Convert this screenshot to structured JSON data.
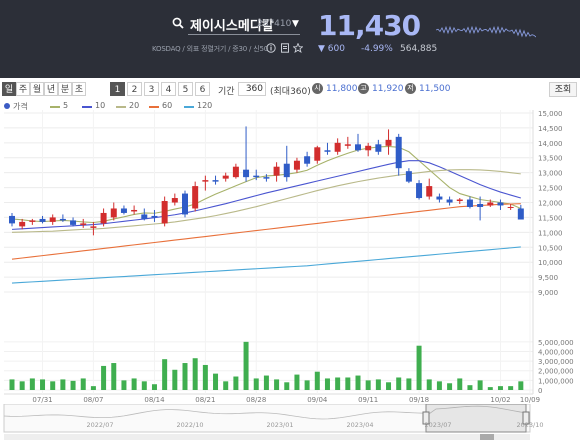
{
  "header": {
    "stock_name": "제이시스메디칼",
    "stock_code": "287410",
    "meta": "KOSDAQ / 외표 정렬거기 / 증30 / 신50",
    "price": "11,430",
    "change": "▼ 600",
    "change_pct": "-4.99%",
    "volume": "564,885",
    "colors": {
      "down": "#a9b8f5",
      "bg": "#2c2f38"
    }
  },
  "toolbar": {
    "periods": [
      "일",
      "주",
      "월",
      "년",
      "분",
      "초"
    ],
    "selected_period": "일",
    "counts": [
      "1",
      "2",
      "3",
      "4",
      "5",
      "6"
    ],
    "selected_count": "1",
    "range_label": "기간",
    "range_value": "360",
    "range_max": "(최대360)",
    "open_badge": "시",
    "open_value": "11,800",
    "high_badge": "고",
    "high_value": "11,920",
    "low_badge": "저",
    "low_value": "11,500",
    "search_label": "조회"
  },
  "legend": [
    {
      "label": "가격",
      "color": "#3b5bc4"
    },
    {
      "label": "5",
      "color": "#a7b26a"
    },
    {
      "label": "10",
      "color": "#4a55d0"
    },
    {
      "label": "20",
      "color": "#b9b98a"
    },
    {
      "label": "60",
      "color": "#e8703a"
    },
    {
      "label": "120",
      "color": "#4aa8d8"
    }
  ],
  "chart_data": {
    "type": "candlestick",
    "x_ticks": [
      "07/31",
      "08/07",
      "08/14",
      "08/21",
      "08/28",
      "09/04",
      "09/11",
      "09/18",
      "10/02",
      "10/09"
    ],
    "y_ticks": [
      9000,
      9500,
      10000,
      10500,
      11000,
      11500,
      12000,
      12500,
      13000,
      13500,
      14000,
      14500,
      15000
    ],
    "y_tick_labels": [
      "9,000",
      "9,500",
      "10,000",
      "10,500",
      "11,000",
      "11,500",
      "12,000",
      "12,500",
      "13,000",
      "13,500",
      "14,000",
      "14,500",
      "15,000"
    ],
    "ylim": [
      8800,
      15100
    ],
    "volume_ticks": [
      0,
      1000000,
      2000000,
      3000000,
      4000000,
      5000000
    ],
    "volume_tick_labels": [
      "0",
      "1,000,000",
      "2,000,000",
      "3,000,000",
      "4,000,000",
      "5,000,000"
    ],
    "candles": [
      {
        "o": 11550,
        "h": 11650,
        "l": 11200,
        "c": 11300
      },
      {
        "o": 11200,
        "h": 11450,
        "l": 11100,
        "c": 11350
      },
      {
        "o": 11350,
        "h": 11450,
        "l": 11250,
        "c": 11400
      },
      {
        "o": 11450,
        "h": 11550,
        "l": 11300,
        "c": 11350
      },
      {
        "o": 11350,
        "h": 11600,
        "l": 11250,
        "c": 11500
      },
      {
        "o": 11450,
        "h": 11600,
        "l": 11350,
        "c": 11400
      },
      {
        "o": 11400,
        "h": 11500,
        "l": 11200,
        "c": 11250
      },
      {
        "o": 11250,
        "h": 11450,
        "l": 11150,
        "c": 11300
      },
      {
        "o": 11150,
        "h": 11350,
        "l": 10900,
        "c": 11200
      },
      {
        "o": 11300,
        "h": 11800,
        "l": 11200,
        "c": 11650
      },
      {
        "o": 11500,
        "h": 12000,
        "l": 11400,
        "c": 11800
      },
      {
        "o": 11800,
        "h": 11900,
        "l": 11600,
        "c": 11650
      },
      {
        "o": 11700,
        "h": 11900,
        "l": 11600,
        "c": 11750
      },
      {
        "o": 11600,
        "h": 11800,
        "l": 11400,
        "c": 11450
      },
      {
        "o": 11550,
        "h": 11750,
        "l": 11350,
        "c": 11500
      },
      {
        "o": 11300,
        "h": 12200,
        "l": 11200,
        "c": 12050
      },
      {
        "o": 12000,
        "h": 12300,
        "l": 11900,
        "c": 12150
      },
      {
        "o": 12300,
        "h": 12400,
        "l": 11500,
        "c": 11600
      },
      {
        "o": 11800,
        "h": 12700,
        "l": 11700,
        "c": 12550
      },
      {
        "o": 12700,
        "h": 12900,
        "l": 12400,
        "c": 12750
      },
      {
        "o": 12750,
        "h": 12900,
        "l": 12600,
        "c": 12700
      },
      {
        "o": 12800,
        "h": 13000,
        "l": 12700,
        "c": 12900
      },
      {
        "o": 12850,
        "h": 13300,
        "l": 12800,
        "c": 13200
      },
      {
        "o": 13100,
        "h": 14550,
        "l": 12700,
        "c": 12850
      },
      {
        "o": 12900,
        "h": 13100,
        "l": 12750,
        "c": 12850
      },
      {
        "o": 12850,
        "h": 12950,
        "l": 12700,
        "c": 12800
      },
      {
        "o": 12900,
        "h": 13350,
        "l": 12700,
        "c": 13200
      },
      {
        "o": 13300,
        "h": 13900,
        "l": 12700,
        "c": 12850
      },
      {
        "o": 13100,
        "h": 13500,
        "l": 13000,
        "c": 13400
      },
      {
        "o": 13550,
        "h": 13700,
        "l": 13200,
        "c": 13300
      },
      {
        "o": 13400,
        "h": 13900,
        "l": 13300,
        "c": 13850
      },
      {
        "o": 13750,
        "h": 14000,
        "l": 13600,
        "c": 13700
      },
      {
        "o": 13700,
        "h": 14150,
        "l": 13600,
        "c": 14000
      },
      {
        "o": 13900,
        "h": 14200,
        "l": 13800,
        "c": 13950
      },
      {
        "o": 13950,
        "h": 14300,
        "l": 13700,
        "c": 13750
      },
      {
        "o": 13750,
        "h": 14000,
        "l": 13550,
        "c": 13900
      },
      {
        "o": 13950,
        "h": 14100,
        "l": 13600,
        "c": 13700
      },
      {
        "o": 13900,
        "h": 14450,
        "l": 13600,
        "c": 14100
      },
      {
        "o": 14200,
        "h": 14300,
        "l": 12900,
        "c": 13150
      },
      {
        "o": 13050,
        "h": 13150,
        "l": 12650,
        "c": 12700
      },
      {
        "o": 12650,
        "h": 12750,
        "l": 12100,
        "c": 12150
      },
      {
        "o": 12200,
        "h": 12800,
        "l": 12100,
        "c": 12550
      },
      {
        "o": 12200,
        "h": 12300,
        "l": 12000,
        "c": 12100
      },
      {
        "o": 12100,
        "h": 12200,
        "l": 11900,
        "c": 12000
      },
      {
        "o": 12050,
        "h": 12150,
        "l": 11950,
        "c": 12100
      },
      {
        "o": 12100,
        "h": 12200,
        "l": 11800,
        "c": 11850
      },
      {
        "o": 11950,
        "h": 12200,
        "l": 11400,
        "c": 11850
      },
      {
        "o": 11900,
        "h": 12100,
        "l": 11850,
        "c": 12000
      },
      {
        "o": 12000,
        "h": 12100,
        "l": 11750,
        "c": 11900
      },
      {
        "o": 11850,
        "h": 11950,
        "l": 11750,
        "c": 11850
      },
      {
        "o": 11800,
        "h": 11920,
        "l": 11500,
        "c": 11430
      }
    ],
    "volumes": [
      1100000,
      900000,
      1200000,
      1100000,
      900000,
      1100000,
      950000,
      1200000,
      400000,
      2500000,
      2800000,
      1000000,
      1200000,
      900000,
      600000,
      3200000,
      2100000,
      2800000,
      3300000,
      2600000,
      1700000,
      900000,
      1400000,
      5000000,
      1200000,
      1500000,
      1100000,
      800000,
      1600000,
      1000000,
      1900000,
      1200000,
      1300000,
      1300000,
      1500000,
      1000000,
      1100000,
      800000,
      1300000,
      1200000,
      4600000,
      1100000,
      900000,
      700000,
      1200000,
      500000,
      1000000,
      300000,
      400000,
      400000,
      900000
    ],
    "ma": {
      "5": [
        11450,
        11420,
        11380,
        11360,
        11380,
        11400,
        11380,
        11350,
        11330,
        11370,
        11450,
        11520,
        11600,
        11650,
        11640,
        11700,
        11780,
        11850,
        11950,
        12120,
        12280,
        12420,
        12560,
        12700,
        12830,
        12890,
        12910,
        12950,
        13000,
        13080,
        13250,
        13400,
        13530,
        13650,
        13760,
        13820,
        13860,
        13880,
        13850,
        13700,
        13400,
        13100,
        12800,
        12500,
        12300,
        12200,
        12100,
        12050,
        12000,
        11950,
        11800
      ],
      "10": [
        11100,
        11120,
        11140,
        11160,
        11180,
        11200,
        11220,
        11240,
        11260,
        11290,
        11330,
        11370,
        11410,
        11450,
        11490,
        11540,
        11590,
        11650,
        11720,
        11800,
        11880,
        11960,
        12050,
        12140,
        12230,
        12320,
        12400,
        12480,
        12560,
        12640,
        12720,
        12800,
        12880,
        12960,
        13040,
        13120,
        13200,
        13280,
        13350,
        13400,
        13400,
        13330,
        13200,
        13050,
        12900,
        12750,
        12600,
        12470,
        12350,
        12250,
        12150
      ],
      "20": [
        11000,
        11010,
        11020,
        11030,
        11040,
        11060,
        11080,
        11100,
        11110,
        11130,
        11160,
        11190,
        11220,
        11250,
        11280,
        11310,
        11350,
        11400,
        11450,
        11500,
        11560,
        11630,
        11700,
        11780,
        11860,
        11950,
        12040,
        12130,
        12220,
        12310,
        12400,
        12480,
        12560,
        12630,
        12700,
        12760,
        12820,
        12870,
        12920,
        12960,
        13000,
        13040,
        13070,
        13090,
        13100,
        13100,
        13090,
        13070,
        13040,
        13000,
        12960
      ],
      "60": [
        10100,
        10140,
        10180,
        10220,
        10260,
        10300,
        10340,
        10380,
        10420,
        10460,
        10500,
        10540,
        10580,
        10620,
        10660,
        10700,
        10740,
        10780,
        10820,
        10860,
        10900,
        10940,
        10980,
        11020,
        11060,
        11100,
        11140,
        11180,
        11220,
        11260,
        11300,
        11340,
        11380,
        11420,
        11460,
        11500,
        11540,
        11580,
        11620,
        11660,
        11700,
        11740,
        11780,
        11820,
        11860,
        11880,
        11900,
        11920,
        11940,
        11950,
        11960
      ],
      "120": [
        9300,
        9320,
        9340,
        9360,
        9380,
        9400,
        9420,
        9440,
        9460,
        9480,
        9500,
        9520,
        9540,
        9560,
        9580,
        9600,
        9620,
        9640,
        9660,
        9680,
        9700,
        9720,
        9740,
        9760,
        9780,
        9800,
        9820,
        9840,
        9860,
        9880,
        9910,
        9940,
        9970,
        10000,
        10030,
        10060,
        10090,
        10120,
        10150,
        10180,
        10210,
        10240,
        10270,
        10300,
        10330,
        10360,
        10390,
        10420,
        10450,
        10480,
        10510
      ]
    },
    "nav_labels": [
      "2022/07",
      "2022/10",
      "2023/01",
      "2023/04",
      "2023/07",
      "2023/10"
    ]
  }
}
